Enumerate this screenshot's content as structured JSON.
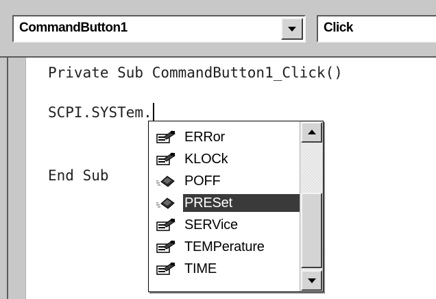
{
  "object_combo": {
    "value": "CommandButton1"
  },
  "procedure_combo": {
    "value": "Click"
  },
  "code": {
    "lines": [
      "Private Sub CommandButton1_Click()",
      "SCPI.SYSTem.",
      "End Sub"
    ]
  },
  "member_list": {
    "items": [
      {
        "label": "ERRor",
        "icon": "property-icon"
      },
      {
        "label": "KLOCk",
        "icon": "property-icon"
      },
      {
        "label": "POFF",
        "icon": "method-icon"
      },
      {
        "label": "PRESet",
        "icon": "method-icon",
        "selected": true
      },
      {
        "label": "SERVice",
        "icon": "property-icon"
      },
      {
        "label": "TEMPerature",
        "icon": "property-icon"
      },
      {
        "label": "TIME",
        "icon": "property-icon"
      }
    ],
    "selected_index": 3
  },
  "colors": {
    "chrome": "#c8c8c8",
    "selection": "#3a3a3a"
  }
}
